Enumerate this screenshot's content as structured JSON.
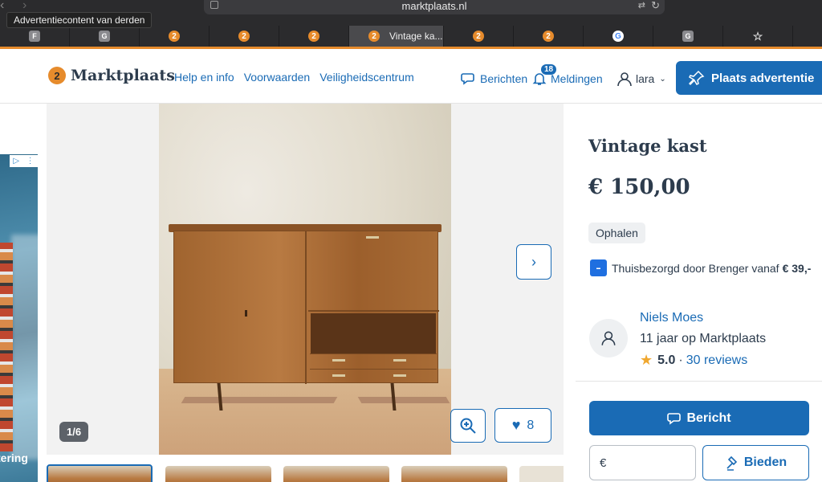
{
  "browser": {
    "url": "marktplaats.nl",
    "tooltip": "Advertentiecontent van derden",
    "tabs": [
      {
        "favicon": "F",
        "kind": "gray"
      },
      {
        "favicon": "G",
        "kind": "gray"
      },
      {
        "favicon": "2",
        "kind": "orange"
      },
      {
        "favicon": "2",
        "kind": "orange"
      },
      {
        "favicon": "2",
        "kind": "orange"
      },
      {
        "favicon": "2",
        "kind": "orange",
        "label": "Vintage ka...",
        "active": true
      },
      {
        "favicon": "2",
        "kind": "orange"
      },
      {
        "favicon": "2",
        "kind": "orange"
      },
      {
        "favicon": "G",
        "kind": "google"
      },
      {
        "favicon": "G",
        "kind": "gray"
      },
      {
        "favicon": "☆",
        "kind": "star"
      }
    ],
    "accent": "#e68b2c"
  },
  "header": {
    "logo_mark": "2",
    "logo_text": "Marktplaats",
    "nav": [
      "Help en info",
      "Voorwaarden",
      "Veiligheidscentrum"
    ],
    "berichten": "Berichten",
    "meldingen": "Meldingen",
    "meldingen_count": "18",
    "user": "lara",
    "place_ad": "Plaats advertentie",
    "brand_color": "#1a6bb5"
  },
  "ad": {
    "text": "tering"
  },
  "gallery": {
    "counter": "1/6",
    "favorites": "8",
    "next_icon": "chevron-right-icon",
    "zoom_icon": "zoom-in-icon"
  },
  "listing": {
    "title": "Vintage kast",
    "price": "€ 150,00",
    "pickup": "Ophalen",
    "delivery_text": "Thuisbezorgd door Brenger vanaf",
    "delivery_price": "€ 39,-"
  },
  "seller": {
    "name": "Niels Moes",
    "years": "11 jaar op Marktplaats",
    "rating": "5.0",
    "separator": "·",
    "reviews": "30 reviews"
  },
  "actions": {
    "message": "Bericht",
    "currency": "€",
    "bid_value": "",
    "bid": "Bieden"
  }
}
